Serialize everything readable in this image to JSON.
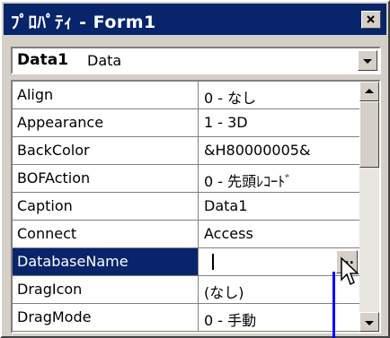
{
  "window": {
    "title": "ﾌﾟﾛﾊﾟﾃｨ - Form1",
    "close_symbol": "×"
  },
  "object_selector": {
    "name": "Data1",
    "type": "Data"
  },
  "properties": [
    {
      "name": "Align",
      "value": "0 - なし"
    },
    {
      "name": "Appearance",
      "value": "1 - 3D"
    },
    {
      "name": "BackColor",
      "value": "&H80000005&"
    },
    {
      "name": "BOFAction",
      "value": "0 - 先頭ﾚｺｰﾄﾞ"
    },
    {
      "name": "Caption",
      "value": "Data1"
    },
    {
      "name": "Connect",
      "value": "Access"
    },
    {
      "name": "DatabaseName",
      "value": ""
    },
    {
      "name": "DragIcon",
      "value": "(なし)"
    },
    {
      "name": "DragMode",
      "value": "0 - 手動"
    }
  ],
  "ellipsis_label": "...",
  "selected_property": "DatabaseName",
  "colors": {
    "title_bg": "#08246b",
    "face": "#d4d0c8",
    "selection": "#08246b",
    "drag_line": "#0000ff"
  }
}
